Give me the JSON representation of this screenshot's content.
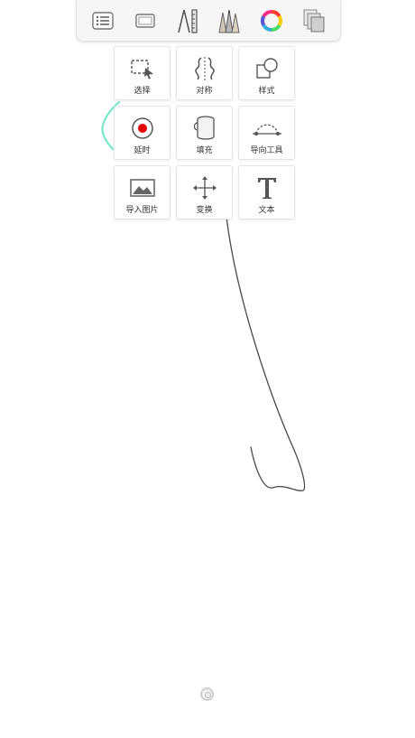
{
  "colors": {
    "accent_stroke": "#6de5c8",
    "ink_stroke": "#4a4a4a",
    "record_dot": "#e60000"
  },
  "toolbar": {
    "buttons": [
      {
        "icon": "list-icon"
      },
      {
        "icon": "canvas-frame-icon"
      },
      {
        "icon": "ruler-pen-icon"
      },
      {
        "icon": "brush-library-icon"
      },
      {
        "icon": "color-wheel-icon"
      },
      {
        "icon": "layers-icon"
      }
    ]
  },
  "tools": [
    {
      "label": "选择",
      "icon": "selection-icon"
    },
    {
      "label": "对称",
      "icon": "symmetry-icon"
    },
    {
      "label": "样式",
      "icon": "shape-style-icon"
    },
    {
      "label": "延时",
      "icon": "time-lapse-record-icon"
    },
    {
      "label": "填充",
      "icon": "fill-bucket-icon"
    },
    {
      "label": "导向工具",
      "icon": "guide-curve-icon"
    },
    {
      "label": "导入图片",
      "icon": "import-image-icon"
    },
    {
      "label": "变换",
      "icon": "transform-move-icon"
    },
    {
      "label": "文本",
      "icon": "text-icon"
    }
  ]
}
